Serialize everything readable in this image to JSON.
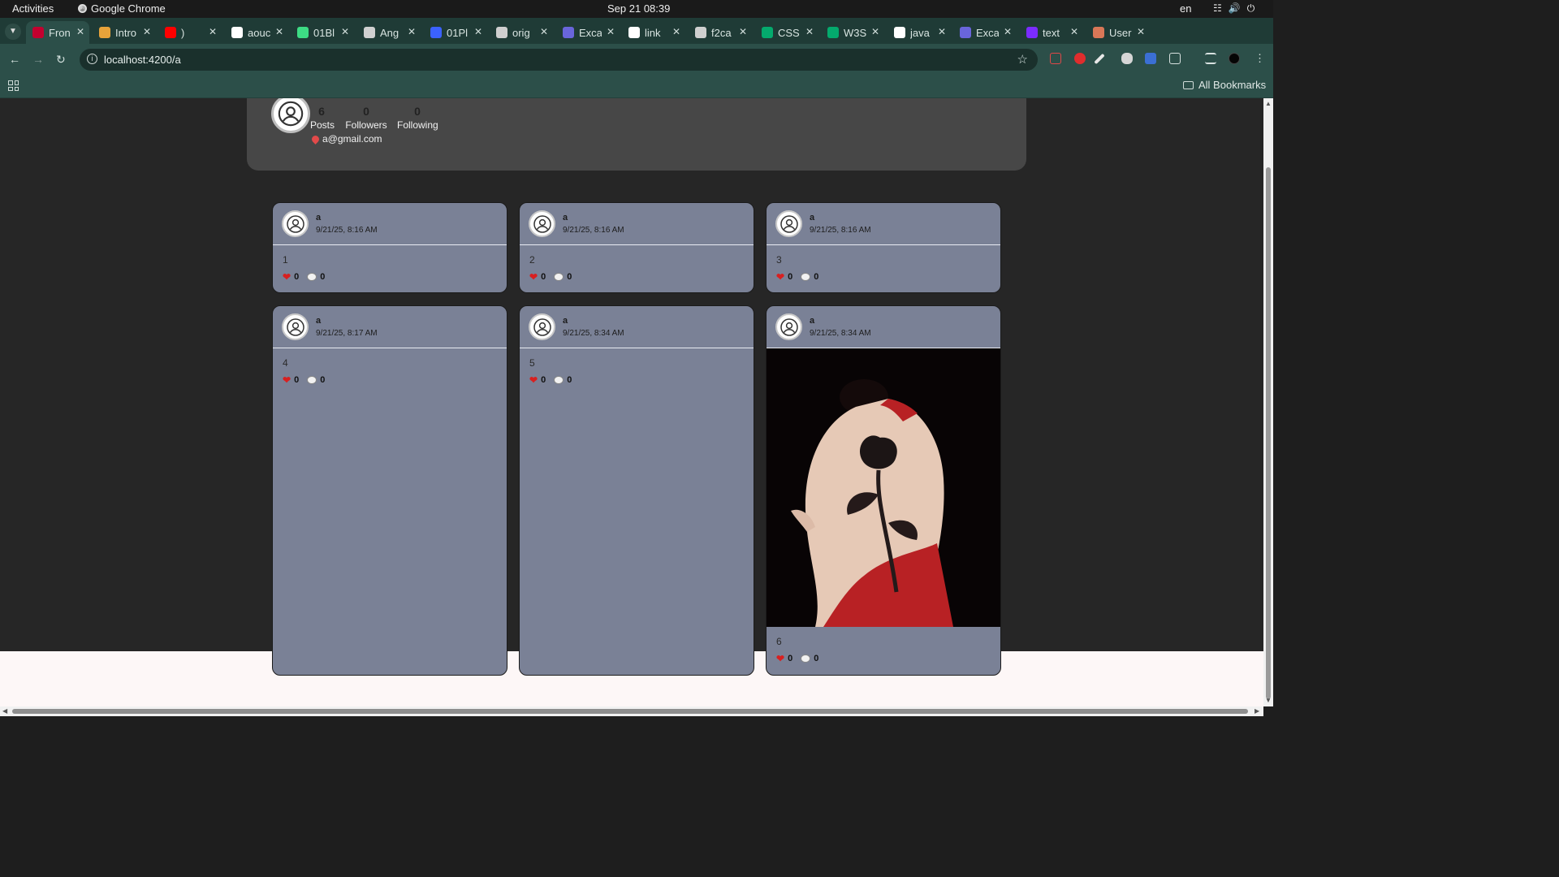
{
  "system_bar": {
    "activities": "Activities",
    "app_name": "Google Chrome",
    "clock": "Sep 21  08:39",
    "language": "en"
  },
  "browser": {
    "tabs": [
      {
        "label": "Fron",
        "favicon": "angular-icon",
        "color": "#c3002f",
        "active": true
      },
      {
        "label": "Intro",
        "favicon": "code-icon",
        "color": "#e8a33a"
      },
      {
        "label": ")",
        "favicon": "youtube-icon",
        "color": "#ff0000"
      },
      {
        "label": "aouc",
        "favicon": "github-icon",
        "color": "#ffffff"
      },
      {
        "label": "01Bl",
        "favicon": "bolt-icon",
        "color": "#3ddc84"
      },
      {
        "label": "Ang",
        "favicon": "openai-icon",
        "color": "#d0d0d0"
      },
      {
        "label": "01Pl",
        "favicon": "bracket-icon",
        "color": "#3b62ff"
      },
      {
        "label": "orig",
        "favicon": "globe-icon",
        "color": "#cfcfcf"
      },
      {
        "label": "Exca",
        "favicon": "excalidraw-icon",
        "color": "#6965db"
      },
      {
        "label": "link",
        "favicon": "google-icon",
        "color": "#ffffff"
      },
      {
        "label": "f2ca",
        "favicon": "globe-icon",
        "color": "#cfcfcf"
      },
      {
        "label": "CSS",
        "favicon": "w3-icon",
        "color": "#04aa6d"
      },
      {
        "label": "W3S",
        "favicon": "w3-icon",
        "color": "#04aa6d"
      },
      {
        "label": "java",
        "favicon": "google-icon",
        "color": "#ffffff"
      },
      {
        "label": "Exca",
        "favicon": "excalidraw-icon",
        "color": "#6965db"
      },
      {
        "label": "text",
        "favicon": "ui-icon",
        "color": "#7b2cff"
      },
      {
        "label": "User",
        "favicon": "claude-icon",
        "color": "#d97757"
      }
    ],
    "url": "localhost:4200/a",
    "all_bookmarks": "All Bookmarks"
  },
  "profile": {
    "stats": [
      {
        "value": "6",
        "label": "Posts"
      },
      {
        "value": "0",
        "label": "Followers"
      },
      {
        "value": "0",
        "label": "Following"
      }
    ],
    "email": "a@gmail.com"
  },
  "posts": [
    {
      "user": "a",
      "date": "9/21/25, 8:16 AM",
      "text": "1",
      "likes": "0",
      "comments": "0"
    },
    {
      "user": "a",
      "date": "9/21/25, 8:16 AM",
      "text": "2",
      "likes": "0",
      "comments": "0"
    },
    {
      "user": "a",
      "date": "9/21/25, 8:16 AM",
      "text": "3",
      "likes": "0",
      "comments": "0"
    },
    {
      "user": "a",
      "date": "9/21/25, 8:17 AM",
      "text": "4",
      "likes": "0",
      "comments": "0"
    },
    {
      "user": "a",
      "date": "9/21/25, 8:34 AM",
      "text": "5",
      "likes": "0",
      "comments": "0"
    },
    {
      "user": "a",
      "date": "9/21/25, 8:34 AM",
      "text": "6",
      "likes": "0",
      "comments": "0",
      "has_image": true
    }
  ]
}
